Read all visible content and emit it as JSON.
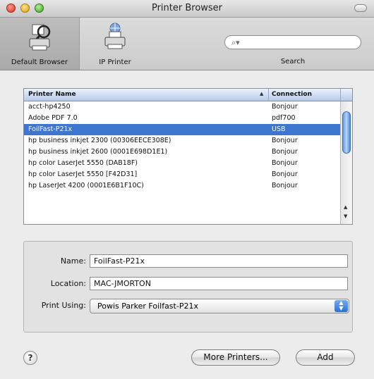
{
  "window": {
    "title": "Printer Browser"
  },
  "toolbar": {
    "default_browser_label": "Default Browser",
    "ip_printer_label": "IP Printer",
    "search_label": "Search",
    "search_value": "",
    "search_icon": "magnifier-icon"
  },
  "list": {
    "headers": {
      "name": "Printer Name",
      "connection": "Connection"
    },
    "sort_indicator": "▲",
    "rows": [
      {
        "name": "acct-hp4250",
        "connection": "Bonjour",
        "selected": false
      },
      {
        "name": "Adobe PDF 7.0",
        "connection": "pdf700",
        "selected": false
      },
      {
        "name": "FoilFast-P21x",
        "connection": "USB",
        "selected": true
      },
      {
        "name": "hp business inkjet 2300 (00306EECE308E)",
        "connection": "Bonjour",
        "selected": false
      },
      {
        "name": "hp business inkjet 2600 (0001E698D1E1)",
        "connection": "Bonjour",
        "selected": false
      },
      {
        "name": "hp color LaserJet 5550 (DAB18F)",
        "connection": "Bonjour",
        "selected": false
      },
      {
        "name": "hp color LaserJet 5550 [F42D31]",
        "connection": "Bonjour",
        "selected": false
      },
      {
        "name": "hp LaserJet 4200 (0001E6B1F10C)",
        "connection": "Bonjour",
        "selected": false
      }
    ]
  },
  "form": {
    "name_label": "Name:",
    "name_value": "FoilFast-P21x",
    "location_label": "Location:",
    "location_value": "MAC-JMORTON",
    "print_using_label": "Print Using:",
    "print_using_value": "Powis Parker Foilfast-P21x"
  },
  "buttons": {
    "help": "?",
    "more_printers": "More Printers...",
    "add": "Add"
  },
  "colors": {
    "selection": "#3e76cf",
    "window_bg": "#ececec"
  }
}
